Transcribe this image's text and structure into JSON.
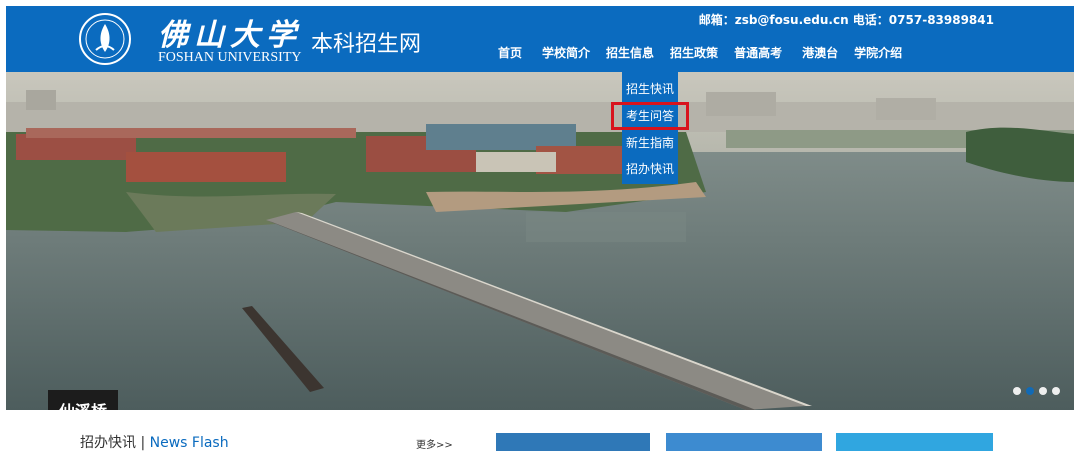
{
  "header": {
    "brand_cn": "佛山大学",
    "brand_en": "FOSHAN UNIVERSITY",
    "site_title": "本科招生网",
    "contact": "邮箱：zsb@fosu.edu.cn 电话：0757-83989841"
  },
  "nav": {
    "items": [
      {
        "label": "首页"
      },
      {
        "label": "学校简介"
      },
      {
        "label": "招生信息"
      },
      {
        "label": "招生政策"
      },
      {
        "label": "普通高考"
      },
      {
        "label": "港澳台"
      },
      {
        "label": "学院介绍"
      }
    ]
  },
  "dropdown": {
    "items": [
      {
        "label": "招生快讯"
      },
      {
        "label": "考生问答"
      },
      {
        "label": "新生指南"
      },
      {
        "label": "招办快讯"
      }
    ],
    "active_index": 1
  },
  "banner": {
    "caption": "仙溪桥",
    "slides": 4,
    "current_slide": 2
  },
  "news": {
    "title_cn": "招办快讯",
    "separator": "|",
    "title_en": "News Flash",
    "more": "更多>>"
  },
  "colors": {
    "header_blue": "#0b6bbf",
    "highlight_red": "#d8131d",
    "tile_1": "#2f78b7",
    "tile_2": "#3d8bd0",
    "tile_3": "#30a6e0"
  }
}
